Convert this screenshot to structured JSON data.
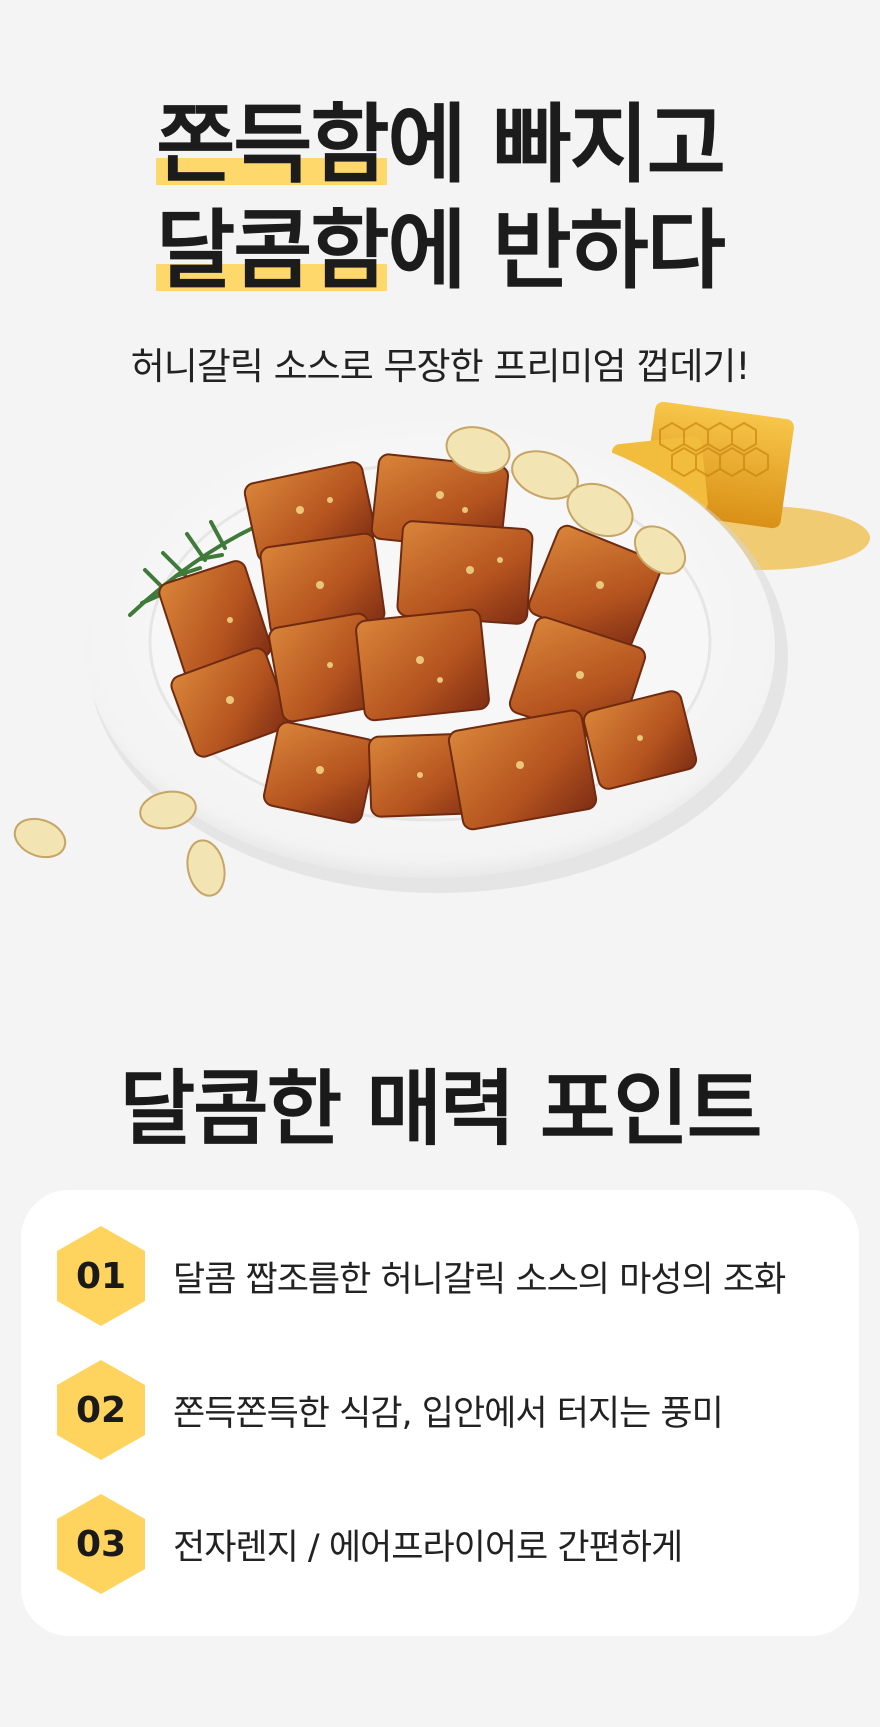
{
  "headline": {
    "line1_highlight": "쫀득함",
    "line1_rest": "에 빠지고",
    "line2_highlight": "달콤함",
    "line2_rest": "에 반하다"
  },
  "subtitle": "허니갈릭 소스로 무장한 프리미엄 껍데기!",
  "colors": {
    "highlight": "#ffd86b",
    "badge": "#ffd45e",
    "background": "#f4f4f4",
    "card": "#ffffff",
    "text": "#1c1c1c"
  },
  "section_title": "달콤한 매력 포인트",
  "points": [
    {
      "number": "01",
      "text": "달콤 짭조름한 허니갈릭 소스의 마성의 조화"
    },
    {
      "number": "02",
      "text": "쫀득쫀득한 식감, 입안에서 터지는 풍미"
    },
    {
      "number": "03",
      "text": "전자렌지 / 에어프라이어로 간편하게"
    }
  ],
  "illustration": {
    "icons": [
      "plate-icon",
      "glazed-pork-skin-icon",
      "garlic-clove-icon",
      "honeycomb-icon",
      "rosemary-icon"
    ]
  }
}
